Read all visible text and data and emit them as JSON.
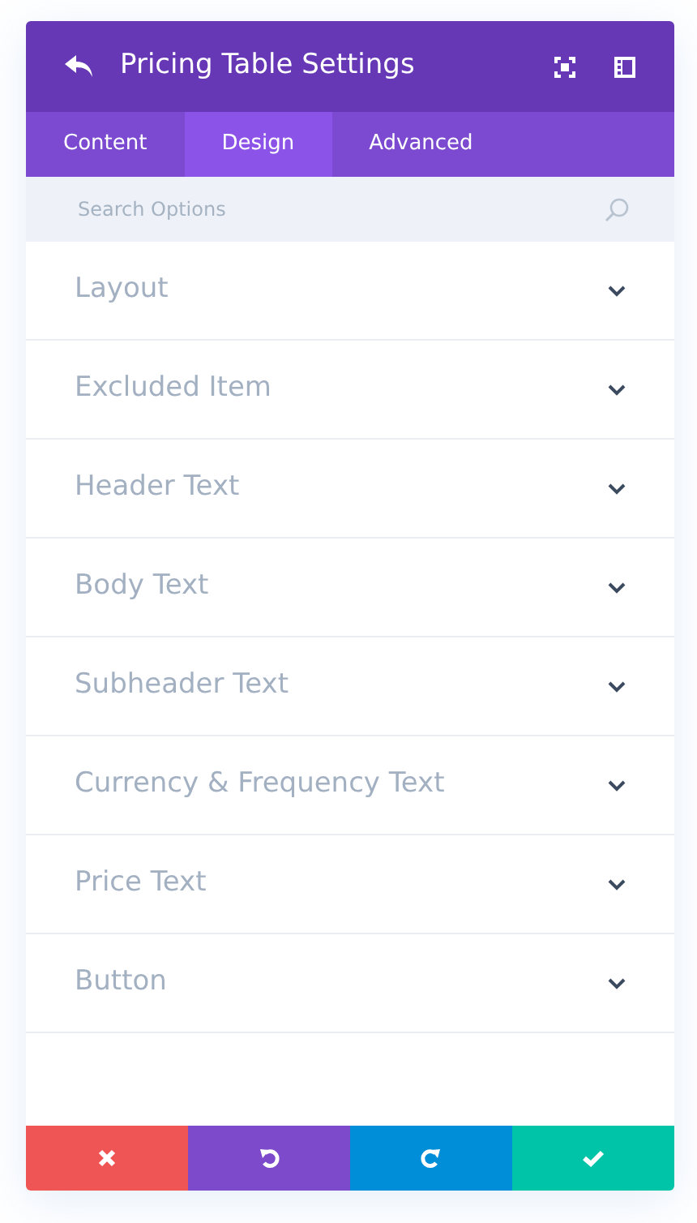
{
  "header": {
    "title": "Pricing Table Settings"
  },
  "tabs": [
    {
      "label": "Content",
      "selected": false
    },
    {
      "label": "Design",
      "selected": true
    },
    {
      "label": "Advanced",
      "selected": false
    }
  ],
  "search": {
    "placeholder": "Search Options"
  },
  "sections": [
    {
      "label": "Layout",
      "expanded": false
    },
    {
      "label": "Excluded Item",
      "expanded": false
    },
    {
      "label": "Header Text",
      "expanded": false
    },
    {
      "label": "Body Text",
      "expanded": false
    },
    {
      "label": "Subheader Text",
      "expanded": false
    },
    {
      "label": "Currency & Frequency Text",
      "expanded": false
    },
    {
      "label": "Price Text",
      "expanded": false
    },
    {
      "label": "Button",
      "expanded": false
    }
  ],
  "footer_buttons": [
    {
      "kind": "cancel",
      "color": "#ef5555"
    },
    {
      "kind": "undo",
      "color": "#7e4acc"
    },
    {
      "kind": "redo",
      "color": "#008ed8"
    },
    {
      "kind": "save",
      "color": "#00c4a8"
    }
  ]
}
